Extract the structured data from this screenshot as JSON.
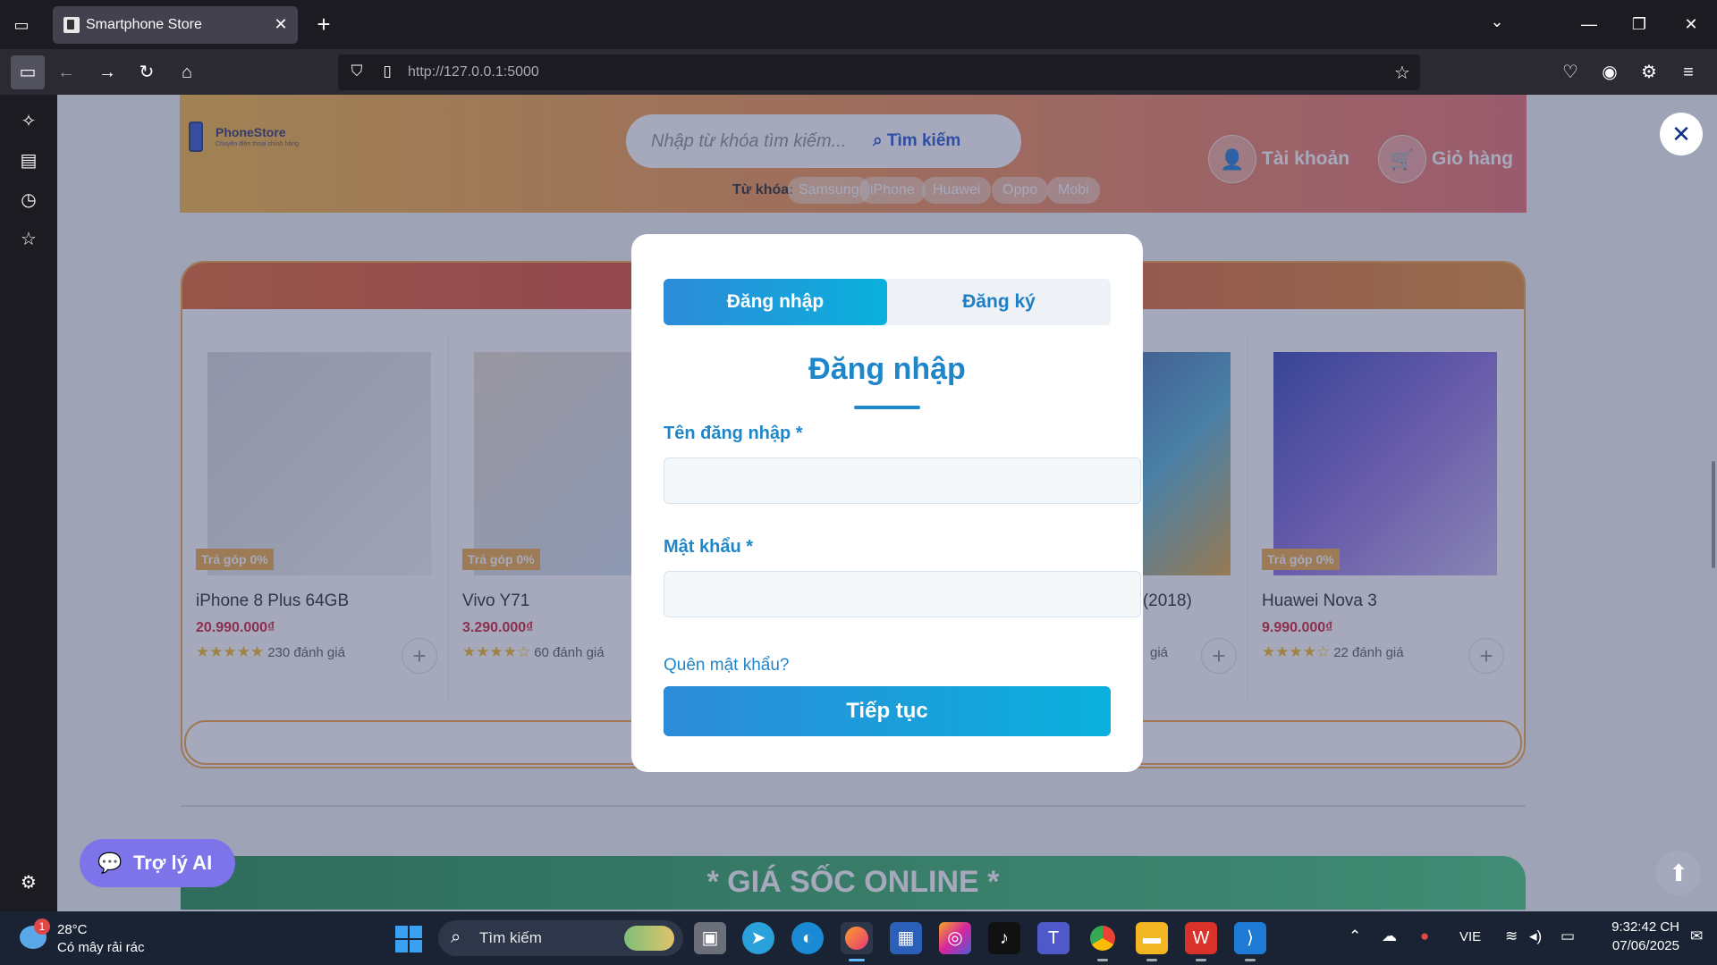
{
  "browser": {
    "tab_title": "Smartphone Store",
    "url_host": "http://127.0.0.1",
    "url_port": ":5000"
  },
  "header": {
    "logo_name": "PhoneStore",
    "logo_tagline": "Chuyên điện thoại chính hãng",
    "search_placeholder": "Nhập từ khóa tìm kiếm...",
    "search_button": "Tìm kiếm",
    "keywords_label": "Từ khóa:",
    "keywords": [
      "Samsung",
      "iPhone",
      "Huawei",
      "Oppo",
      "Mobi"
    ],
    "account_label": "Tài khoản",
    "cart_label": "Giỏ hàng"
  },
  "products": [
    {
      "badge": "Trả góp 0%",
      "name": "iPhone 8 Plus 64GB",
      "price": "20.990.000₫",
      "rating": 5,
      "stars": "★★★★★",
      "reviews": "230 đánh giá"
    },
    {
      "badge": "Trả góp 0%",
      "name": "Vivo Y71",
      "price": "3.290.000₫",
      "rating": 4,
      "stars": "★★★★☆",
      "reviews": "60 đánh giá"
    },
    {
      "badge": "",
      "name": "",
      "price": "",
      "rating": 0,
      "stars": "",
      "reviews": ""
    },
    {
      "badge": "",
      "name": "7 (2018)",
      "price": "",
      "rating": 0,
      "stars": "",
      "reviews": "giá"
    },
    {
      "badge": "Trả góp 0%",
      "name": "Huawei Nova 3",
      "price": "9.990.000₫",
      "rating": 4,
      "stars": "★★★★☆",
      "reviews": "22 đánh giá"
    }
  ],
  "section2_title": "* GIÁ SỐC ONLINE *",
  "modal": {
    "tab_login": "Đăng nhập",
    "tab_register": "Đăng ký",
    "title": "Đăng nhập",
    "username_label": "Tên đăng nhập *",
    "username_value": "",
    "password_label": "Mật khẩu *",
    "password_value": "",
    "forgot": "Quên mật khẩu?",
    "submit": "Tiếp tục"
  },
  "ai_chat_label": "Trợ lý AI",
  "taskbar": {
    "weather_temp": "28°C",
    "weather_desc": "Có mây rải rác",
    "weather_badge": "1",
    "search_label": "Tìm kiếm",
    "language": "VIE",
    "time": "9:32:42 CH",
    "date": "07/06/2025"
  },
  "colors": {
    "primary": "#1f86c9",
    "accent_gradient_start": "#2d8bd8",
    "accent_gradient_end": "#0ab0dc",
    "price_red": "#d0142c",
    "install_badge": "#f0a840"
  }
}
